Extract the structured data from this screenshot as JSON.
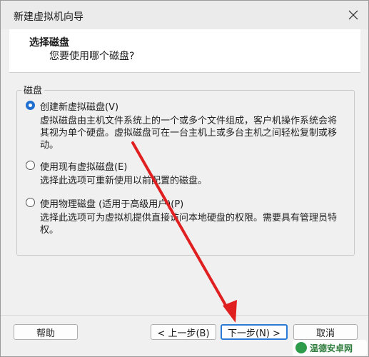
{
  "window": {
    "title": "新建虚拟机向导",
    "close_icon": "close-icon"
  },
  "header": {
    "title": "选择磁盘",
    "subtitle": "您要使用哪个磁盘?"
  },
  "disk_group": {
    "label": "磁盘",
    "options": [
      {
        "label": "创建新虚拟磁盘(V)",
        "checked": true,
        "description": "虚拟磁盘由主机文件系统上的一个或多个文件组成，客户机操作系统会将其视为单个硬盘。虚拟磁盘可在一台主机上或多台主机之间轻松复制或移动。"
      },
      {
        "label": "使用现有虚拟磁盘(E)",
        "checked": false,
        "description": "选择此选项可重新使用以前配置的磁盘。"
      },
      {
        "label": "使用物理磁盘 (适用于高级用户)(P)",
        "checked": false,
        "description": "选择此选项可为虚拟机提供直接访问本地硬盘的权限。需要具有管理员特权。"
      }
    ]
  },
  "footer": {
    "help_label": "帮助",
    "back_label": "< 上一步(B)",
    "next_label": "下一步(N) >",
    "cancel_label": "取消"
  },
  "annotation": {
    "arrow_color": "#e02020"
  },
  "watermark": {
    "text": "温德安卓网"
  },
  "colors": {
    "accent": "#1f6fd1",
    "primary_border": "#2b7ad6"
  }
}
